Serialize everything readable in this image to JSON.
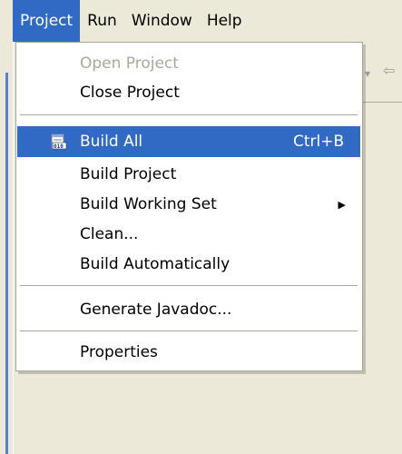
{
  "menubar": {
    "items": [
      {
        "label": "Project"
      },
      {
        "label": "Run"
      },
      {
        "label": "Window"
      },
      {
        "label": "Help"
      }
    ]
  },
  "menu": {
    "open_project": "Open Project",
    "close_project": "Close Project",
    "build_all": "Build All",
    "build_all_shortcut": "Ctrl+B",
    "build_project": "Build Project",
    "build_working_set": "Build Working Set",
    "clean": "Clean...",
    "build_automatically": "Build Automatically",
    "generate_javadoc": "Generate Javadoc...",
    "properties": "Properties"
  },
  "icons": {
    "build_all": "build-binary-icon",
    "submenu": "submenu-arrow-icon"
  },
  "colors": {
    "highlight": "#316ac5",
    "menu_bg": "#ffffff",
    "window_bg": "#ece9d8",
    "disabled_text": "#aca899"
  }
}
